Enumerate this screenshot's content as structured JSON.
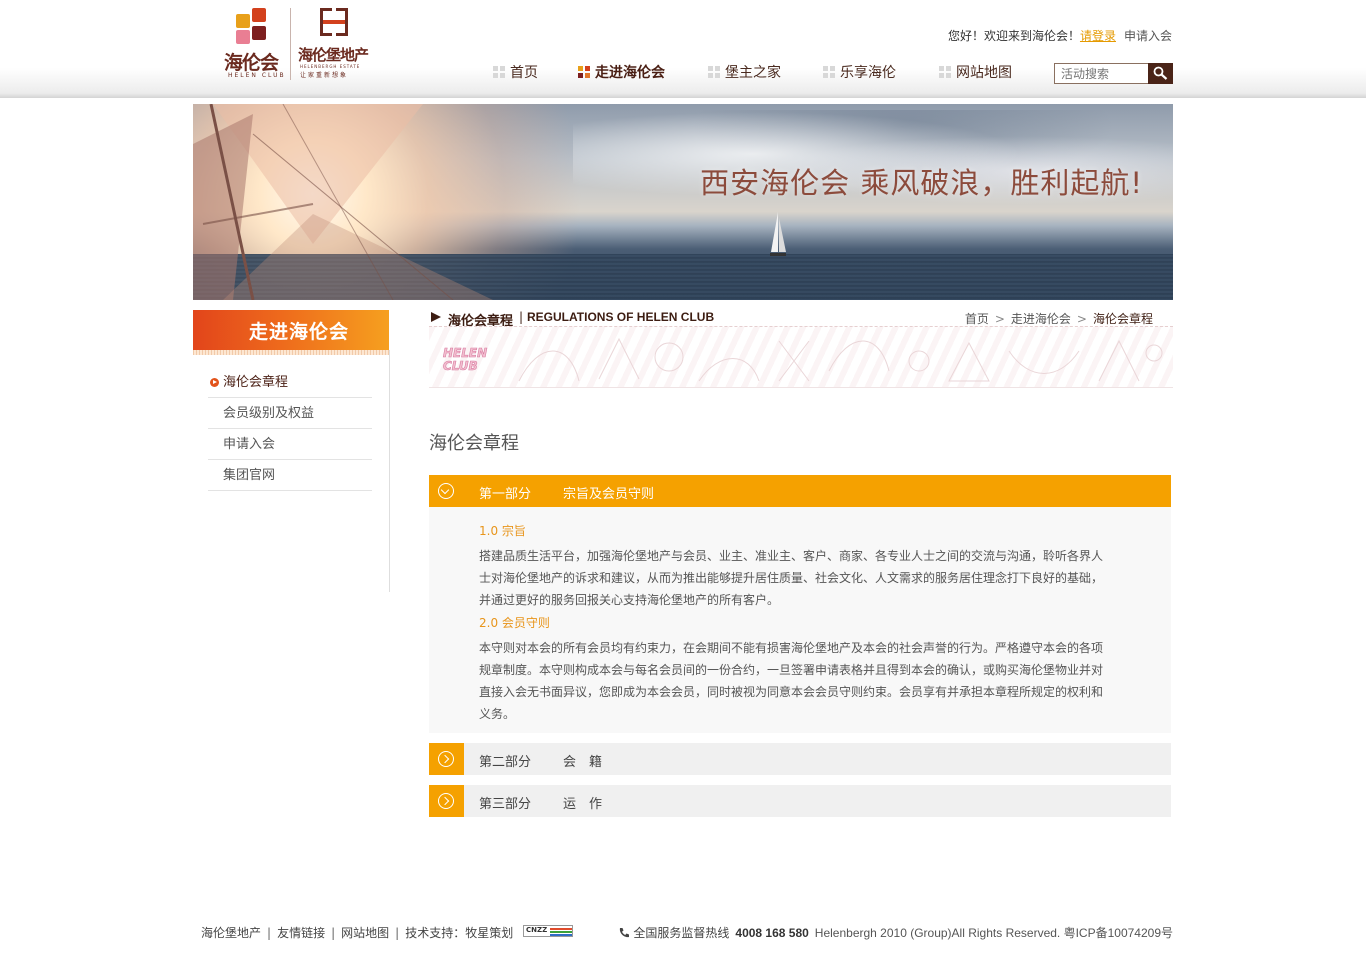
{
  "header": {
    "logo_club_text": "海伦会",
    "logo_club_sub": "HELEN CLUB",
    "logo_estate_text": "海伦堡地产",
    "logo_estate_sub_en": "HELENBERGH ESTATE",
    "logo_estate_slogan": "让家重新想象",
    "welcome": "您好！欢迎来到海伦会！",
    "login": "请登录",
    "join": "申请入会",
    "nav": [
      "首页",
      "走进海伦会",
      "堡主之家",
      "乐享海伦",
      "网站地图"
    ],
    "nav_active": "走进海伦会",
    "search_placeholder": "活动搜索",
    "colors": {
      "brand_brown": "#4a2418",
      "accent_orange": "#f5a100",
      "accent_red": "#e2451b"
    }
  },
  "banner": {
    "caption": "西安海伦会  乘风破浪，胜利起航!"
  },
  "sidebar": {
    "title": "走进海伦会",
    "items": [
      "海伦会章程",
      "会员级别及权益",
      "申请入会",
      "集团官网"
    ],
    "active": "海伦会章程"
  },
  "section": {
    "title_cn": "海伦会章程",
    "title_sep": "|",
    "title_en": "REGULATIONS OF HELEN CLUB",
    "breadcrumb": [
      "首页",
      "走进海伦会",
      "海伦会章程"
    ],
    "strip_label_1": "HELEN",
    "strip_label_2": "CLUB",
    "page_title": "海伦会章程"
  },
  "accordion": [
    {
      "part": "第一部分",
      "title": "宗旨及会员守则",
      "open": true,
      "clauses": [
        {
          "heading": "1.0 宗旨",
          "text": "搭建品质生活平台，加强海伦堡地产与会员、业主、准业主、客户、商家、各专业人士之间的交流与沟通，聆听各界人士对海伦堡地产的诉求和建议，从而为推出能够提升居住质量、社会文化、人文需求的服务居住理念打下良好的基础，并通过更好的服务回报关心支持海伦堡地产的所有客户。"
        },
        {
          "heading": "2.0 会员守则",
          "text": "本守则对本会的所有会员均有约束力，在会期间不能有损害海伦堡地产及本会的社会声誉的行为。严格遵守本会的各项规章制度。本守则构成本会与每名会员间的一份合约，一旦签署申请表格并且得到本会的确认，或购买海伦堡物业并对直接入会无书面异议，您即成为本会会员，同时被视为同意本会会员守则约束。会员享有并承担本章程所规定的权利和义务。"
        }
      ]
    },
    {
      "part": "第二部分",
      "title": "会　籍",
      "open": false
    },
    {
      "part": "第三部分",
      "title": "运　作",
      "open": false
    }
  ],
  "footer": {
    "links": [
      "海伦堡地产",
      "友情链接",
      "网站地图",
      "技术支持：牧星策划"
    ],
    "cnzz": "CNZZ",
    "hotline_label": "全国服务监督热线",
    "hotline": "4008 168 580",
    "copyright": "Helenbergh 2010 (Group)All Rights Reserved. 粤ICP备10074209号"
  }
}
